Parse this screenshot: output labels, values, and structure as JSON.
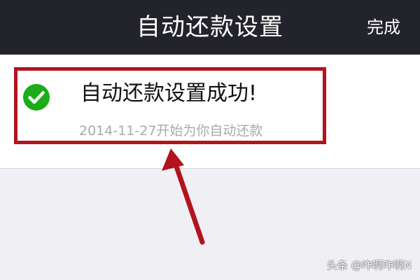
{
  "header": {
    "title": "自动还款设置",
    "done_label": "完成"
  },
  "status": {
    "icon": "check-circle-icon",
    "title": "自动还款设置成功!",
    "subtitle": "2014-11-27开始为你自动还款"
  },
  "watermark": {
    "text": "头条 @咋啊咋啊N"
  },
  "colors": {
    "nav_background": "#23232b",
    "success_green": "#1aad19",
    "annotation_red": "#b3121f",
    "page_background": "#efeff4"
  }
}
